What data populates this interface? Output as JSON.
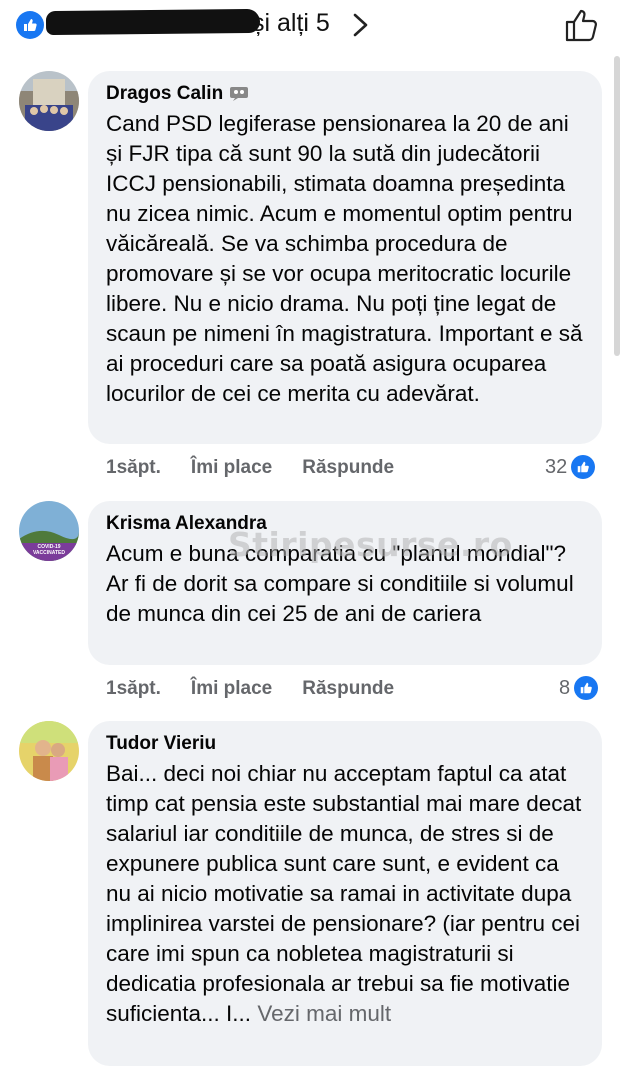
{
  "header": {
    "reactors_suffix": "și alți 5"
  },
  "comments": [
    {
      "author": "Dragos Calin",
      "text": "Cand PSD legiferase pensionarea la 20 de ani și FJR tipa că sunt 90 la sută din judecătorii ICCJ pensionabili, stimata doamna președinta nu zicea nimic. Acum e momentul optim pentru văicăreală. Se va schimba procedura de promovare și se vor ocupa meritocratic locurile libere. Nu e nicio drama. Nu poți ține legat de scaun pe nimeni în magistratura. Important e să ai proceduri care sa poată asigura ocuparea locurilor de cei ce merita cu adevărat.",
      "time": "1săpt.",
      "like_label": "Îmi place",
      "reply_label": "Răspunde",
      "likes": "32"
    },
    {
      "author": "Krisma Alexandra",
      "text": "Acum e buna comparatia cu \"planul mondial\"? Ar fi de dorit sa compare si conditiile si volumul de munca din cei 25 de ani de cariera",
      "time": "1săpt.",
      "like_label": "Îmi place",
      "reply_label": "Răspunde",
      "likes": "8",
      "avatar_text": "COVID-19 VACCINATED"
    },
    {
      "author": "Tudor Vieriu",
      "text": "Bai... deci noi chiar nu acceptam faptul ca atat timp cat pensia este substantial mai mare decat salariul iar conditiile de munca, de stres si de expunere publica sunt care sunt, e evident ca nu ai nicio motivatie sa ramai in activitate dupa implinirea varstei de pensionare? (iar pentru cei care imi spun ca nobletea magistraturii si dedicatia profesionala ar trebui sa fie motivatie suficienta... I...",
      "see_more": "Vezi mai mult"
    }
  ],
  "watermark": "Stiripesurse.ro",
  "colors": {
    "accent": "#1877f2",
    "bubble": "#f0f2f5",
    "muted": "#65676b"
  }
}
